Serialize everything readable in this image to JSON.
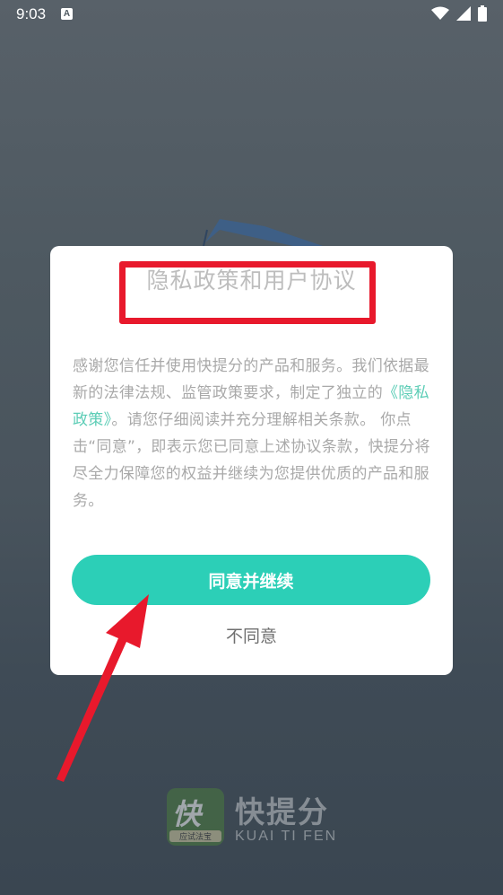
{
  "status_bar": {
    "time": "9:03",
    "notification_icon": "A"
  },
  "dialog": {
    "title": "隐私政策和用户协议",
    "body_before_link": "感谢您信任并使用快提分的产品和服务。我们依据最新的法律法规、监管政策要求，制定了独立的",
    "policy_link": "《隐私政策》",
    "body_after_link": "。请您仔细阅读并充分理解相关条款。 你点击“同意”，即表示您已同意上述协议条款，快提分将尽全力保障您的权益并继续为您提供优质的产品和服务。",
    "agree_label": "同意并继续",
    "disagree_label": "不同意"
  },
  "branding": {
    "logo_char": "快",
    "logo_caption": "应试法宝",
    "app_name": "快提分",
    "app_subtitle": "KUAI TI FEN"
  },
  "colors": {
    "accent": "#2ccfb7",
    "link": "#5ccdb6",
    "highlight_box": "#e8192c",
    "arrow": "#e8192c"
  }
}
